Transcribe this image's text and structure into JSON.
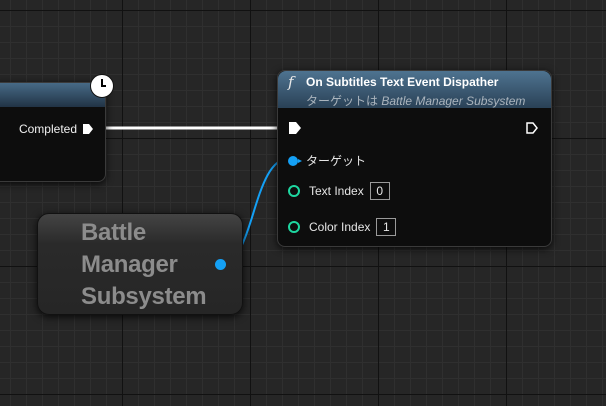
{
  "left_node": {
    "output_label": "Completed"
  },
  "function_node": {
    "title": "On Subtitles Text Event Dispather",
    "subtitle_prefix": "ターゲットは ",
    "subtitle_target": "Battle Manager Subsystem",
    "icon": "function-icon",
    "pins": {
      "target_label": "ターゲット",
      "text_index_label": "Text Index",
      "text_index_value": "0",
      "color_index_label": "Color Index",
      "color_index_value": "1"
    }
  },
  "battle_manager_node": {
    "label": "Battle\nManager\nSubsystem"
  },
  "colors": {
    "object_pin": "#14a0f5",
    "int_pin": "#1ed6a0",
    "exec_wire": "#ffffff",
    "header": "#3d5b74",
    "grid_bg": "#262626"
  }
}
